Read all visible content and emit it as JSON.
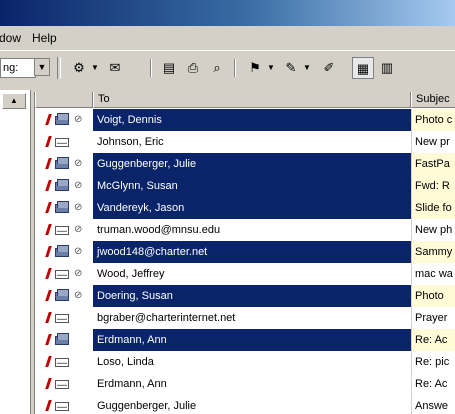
{
  "menu": {
    "window": "dow",
    "help": "Help"
  },
  "toolbar": {
    "combo_text": "ng:"
  },
  "list": {
    "columns": {
      "to": "To",
      "subject": "Subjec"
    },
    "rows": [
      {
        "to": "Voigt, Dennis",
        "subject": "Photo c",
        "selected": true,
        "read": true,
        "attach": true
      },
      {
        "to": "Johnson, Eric",
        "subject": "New pr",
        "selected": false,
        "read": false,
        "attach": false
      },
      {
        "to": "Guggenberger, Julie",
        "subject": "FastPa",
        "selected": true,
        "read": true,
        "attach": true
      },
      {
        "to": "McGlynn, Susan",
        "subject": "Fwd: R",
        "selected": true,
        "read": true,
        "attach": true
      },
      {
        "to": "Vandereyk, Jason",
        "subject": "Slide fo",
        "selected": true,
        "read": true,
        "attach": true
      },
      {
        "to": "truman.wood@mnsu.edu",
        "subject": "New ph",
        "selected": false,
        "read": false,
        "attach": true
      },
      {
        "to": "jwood148@charter.net",
        "subject": "Sammy",
        "selected": true,
        "read": true,
        "attach": true
      },
      {
        "to": "Wood, Jeffrey",
        "subject": "mac wa",
        "selected": false,
        "read": false,
        "attach": true
      },
      {
        "to": "Doering, Susan",
        "subject": "Photo",
        "selected": true,
        "read": true,
        "attach": true
      },
      {
        "to": "bgraber@charterinternet.net",
        "subject": "Prayer",
        "selected": false,
        "read": false,
        "attach": false
      },
      {
        "to": "Erdmann, Ann",
        "subject": "Re: Ac",
        "selected": true,
        "read": true,
        "attach": false
      },
      {
        "to": "Loso, Linda",
        "subject": "Re: pic",
        "selected": false,
        "read": false,
        "attach": false
      },
      {
        "to": "Erdmann, Ann",
        "subject": "Re: Ac",
        "selected": false,
        "read": false,
        "attach": false
      },
      {
        "to": "Guggenberger, Julie",
        "subject": "Answe",
        "selected": false,
        "read": false,
        "attach": false
      }
    ]
  },
  "colors": {
    "selection": "#0a246a",
    "flag": "#c00000",
    "subject_selected_bg": "#fffbd7"
  }
}
